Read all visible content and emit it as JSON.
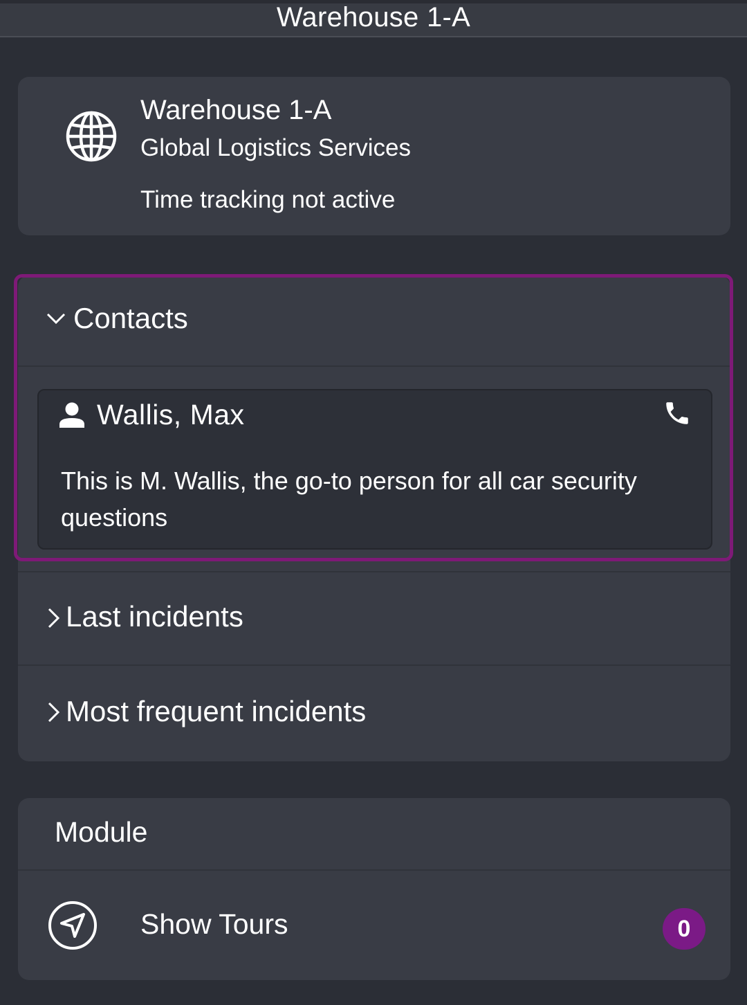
{
  "topbar": {
    "title": "Warehouse 1-A"
  },
  "site": {
    "icon": "globe-icon",
    "title": "Warehouse 1-A",
    "subtitle": "Global Logistics Services",
    "status": "Time tracking not active"
  },
  "accordion": {
    "contacts": {
      "label": "Contacts",
      "expanded": true,
      "highlight_color": "#7e1a77"
    },
    "last_incidents": {
      "label": "Last incidents",
      "expanded": false
    },
    "frequent_incidents": {
      "label": "Most frequent incidents",
      "expanded": false
    }
  },
  "contact": {
    "icon": "person-icon",
    "name": "Wallis, Max",
    "action_icon": "phone-icon",
    "description": "This is M. Wallis, the go-to person for all car security questions"
  },
  "module": {
    "title": "Module",
    "items": [
      {
        "icon": "navigation-arrow-icon",
        "label": "Show Tours",
        "count": "0",
        "badge_color": "#7b1a86"
      }
    ]
  },
  "colors": {
    "background": "#2b2e36",
    "card": "#393c45",
    "contact_card": "#2d3038",
    "text": "#ffffff"
  }
}
